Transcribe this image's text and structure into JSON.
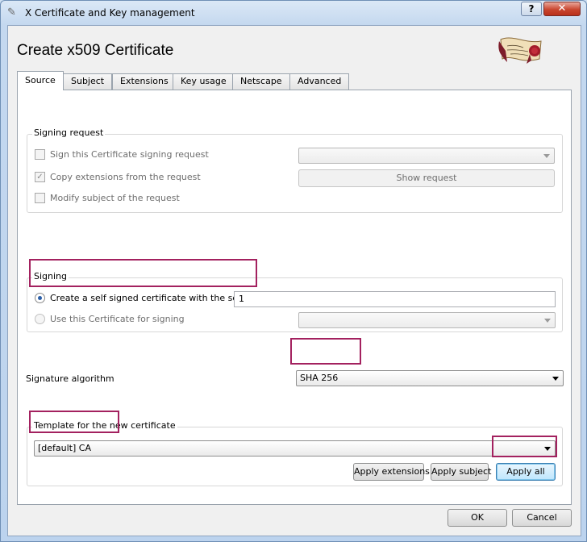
{
  "window": {
    "title": "X Certificate and Key management"
  },
  "titlebar_buttons": {
    "help": "?",
    "close": "✕"
  },
  "page_title": "Create x509 Certificate",
  "tabs": [
    {
      "label": "Source",
      "active": true
    },
    {
      "label": "Subject",
      "active": false
    },
    {
      "label": "Extensions",
      "active": false
    },
    {
      "label": "Key usage",
      "active": false
    },
    {
      "label": "Netscape",
      "active": false
    },
    {
      "label": "Advanced",
      "active": false
    }
  ],
  "signing_request": {
    "group_label": "Signing request",
    "sign_csr": {
      "label": "Sign this Certificate signing request",
      "checked": false,
      "enabled": false
    },
    "copy_ext": {
      "label": "Copy extensions from the request",
      "checked": true,
      "enabled": false
    },
    "modify_subject": {
      "label": "Modify subject of the request",
      "checked": false,
      "enabled": false
    },
    "request_select": {
      "value": "",
      "enabled": false
    },
    "show_request_button": "Show request"
  },
  "signing": {
    "group_label": "Signing",
    "self_signed": {
      "label": "Create a self signed certificate with the serial",
      "selected": true
    },
    "serial_value": "1",
    "use_cert": {
      "label": "Use this Certificate for signing",
      "selected": false,
      "enabled": false
    },
    "cert_select": {
      "value": "",
      "enabled": false
    }
  },
  "signature_algorithm": {
    "label": "Signature algorithm",
    "value": "SHA 256"
  },
  "template": {
    "group_label": "Template for the new certificate",
    "value": "[default] CA",
    "apply_extensions": "Apply extensions",
    "apply_subject": "Apply subject",
    "apply_all": "Apply all"
  },
  "footer": {
    "ok": "OK",
    "cancel": "Cancel"
  },
  "colors": {
    "highlight": "#a3215f",
    "accent": "#2b5fa8"
  }
}
